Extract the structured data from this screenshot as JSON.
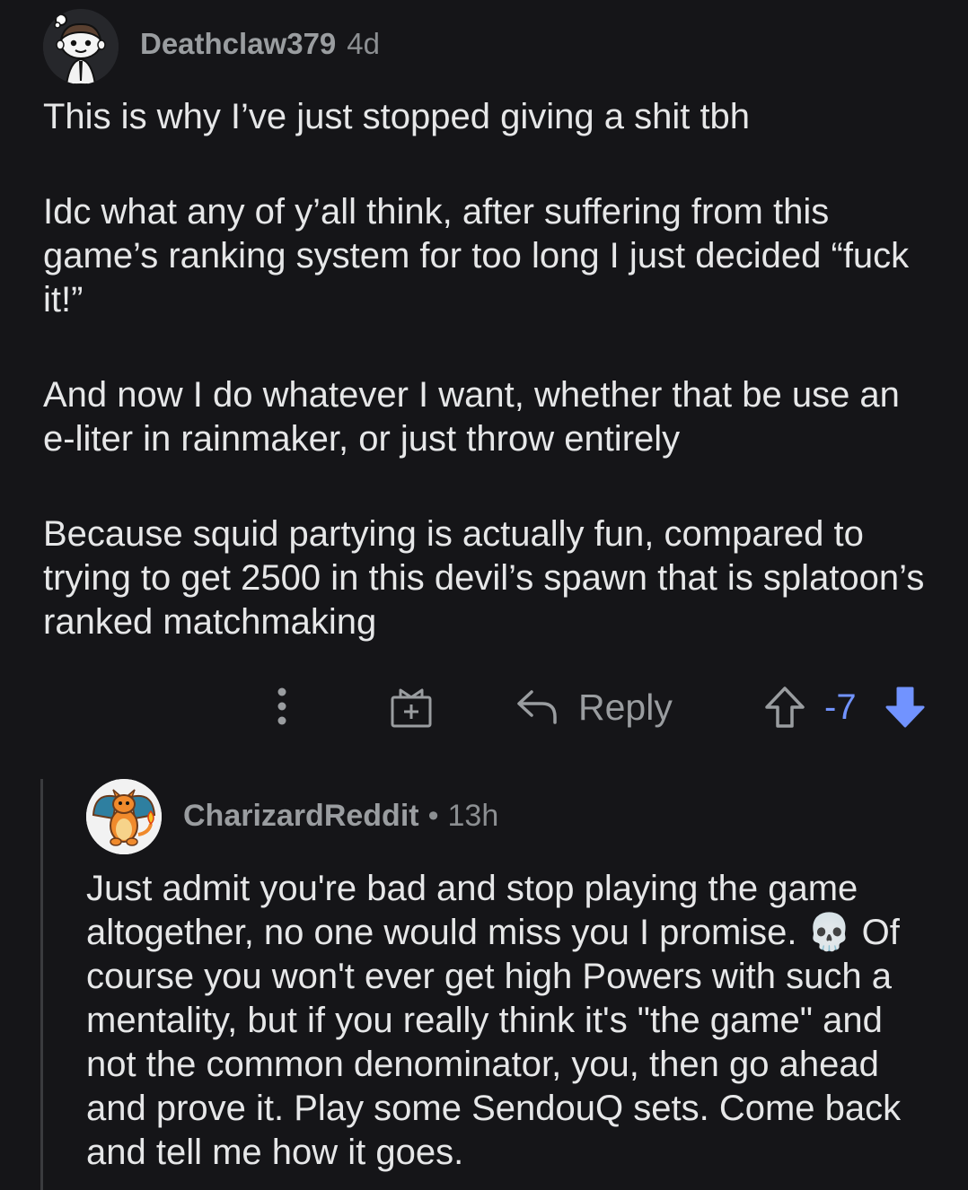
{
  "comments": [
    {
      "username": "Deathclaw379",
      "age": "4d",
      "paragraphs": [
        "This is why I’ve just stopped giving a shit tbh",
        "Idc what any of y’all think, after suffering from this game’s ranking system for too long I just decided “fuck it!”",
        "And now I do whatever I want, whether that be use an e-liter in rainmaker, or just throw entirely",
        "Because squid partying is actually fun, compared to trying to get 2500 in this devil’s spawn that is splatoon’s ranked matchmaking"
      ],
      "actions": {
        "reply_label": "Reply",
        "score": "-7",
        "vote_state": "downvoted"
      },
      "avatar_icon": "snoo-avatar-icon"
    },
    {
      "username": "CharizardReddit",
      "separator": "•",
      "age": "13h",
      "paragraphs": [
        "Just admit you're bad and stop playing the game altogether, no one would miss you I promise. 💀 Of course you won't ever get high Powers with such a mentality, but if you really think it's \"the game\" and not the common denominator, you, then go ahead and prove it. Play some SendouQ sets. Come back and tell me how it goes."
      ],
      "avatar_icon": "charizard-avatar-icon"
    }
  ],
  "colors": {
    "background": "#151518",
    "text": "#e6e7e8",
    "meta": "#9a9da0",
    "downvote": "#7193ff",
    "thread_line": "#3a3b3e"
  },
  "icons": {
    "more": "more-vertical-icon",
    "award": "award-icon",
    "reply": "reply-arrow-icon",
    "upvote": "upvote-outline-icon",
    "downvote": "downvote-filled-icon"
  }
}
